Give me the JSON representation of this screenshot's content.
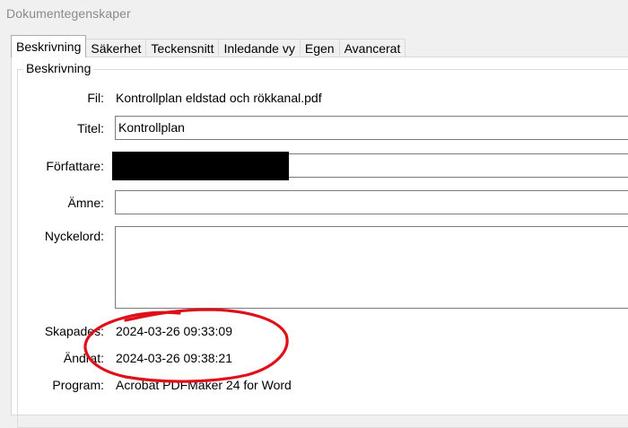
{
  "window": {
    "title": "Dokumentegenskaper"
  },
  "tabs": [
    {
      "label": "Beskrivning",
      "active": true
    },
    {
      "label": "Säkerhet",
      "active": false
    },
    {
      "label": "Teckensnitt",
      "active": false
    },
    {
      "label": "Inledande vy",
      "active": false
    },
    {
      "label": "Egen",
      "active": false
    },
    {
      "label": "Avancerat",
      "active": false
    }
  ],
  "description": {
    "group_label": "Beskrivning",
    "file_label": "Fil:",
    "file_value": "Kontrollplan eldstad och rökkanal.pdf",
    "title_label": "Titel:",
    "title_value": "Kontrollplan",
    "author_label": "Författare:",
    "author_value": "",
    "subject_label": "Ämne:",
    "subject_value": "",
    "keywords_label": "Nyckelord:",
    "keywords_value": "",
    "created_label": "Skapades:",
    "created_value": "2024-03-26 09:33:09",
    "modified_label": "Ändrat:",
    "modified_value": "2024-03-26 09:38:21",
    "program_label": "Program:",
    "program_value": "Acrobat PDFMaker 24 for Word"
  },
  "colors": {
    "annotation": "#e0101a",
    "redaction": "#000000"
  }
}
